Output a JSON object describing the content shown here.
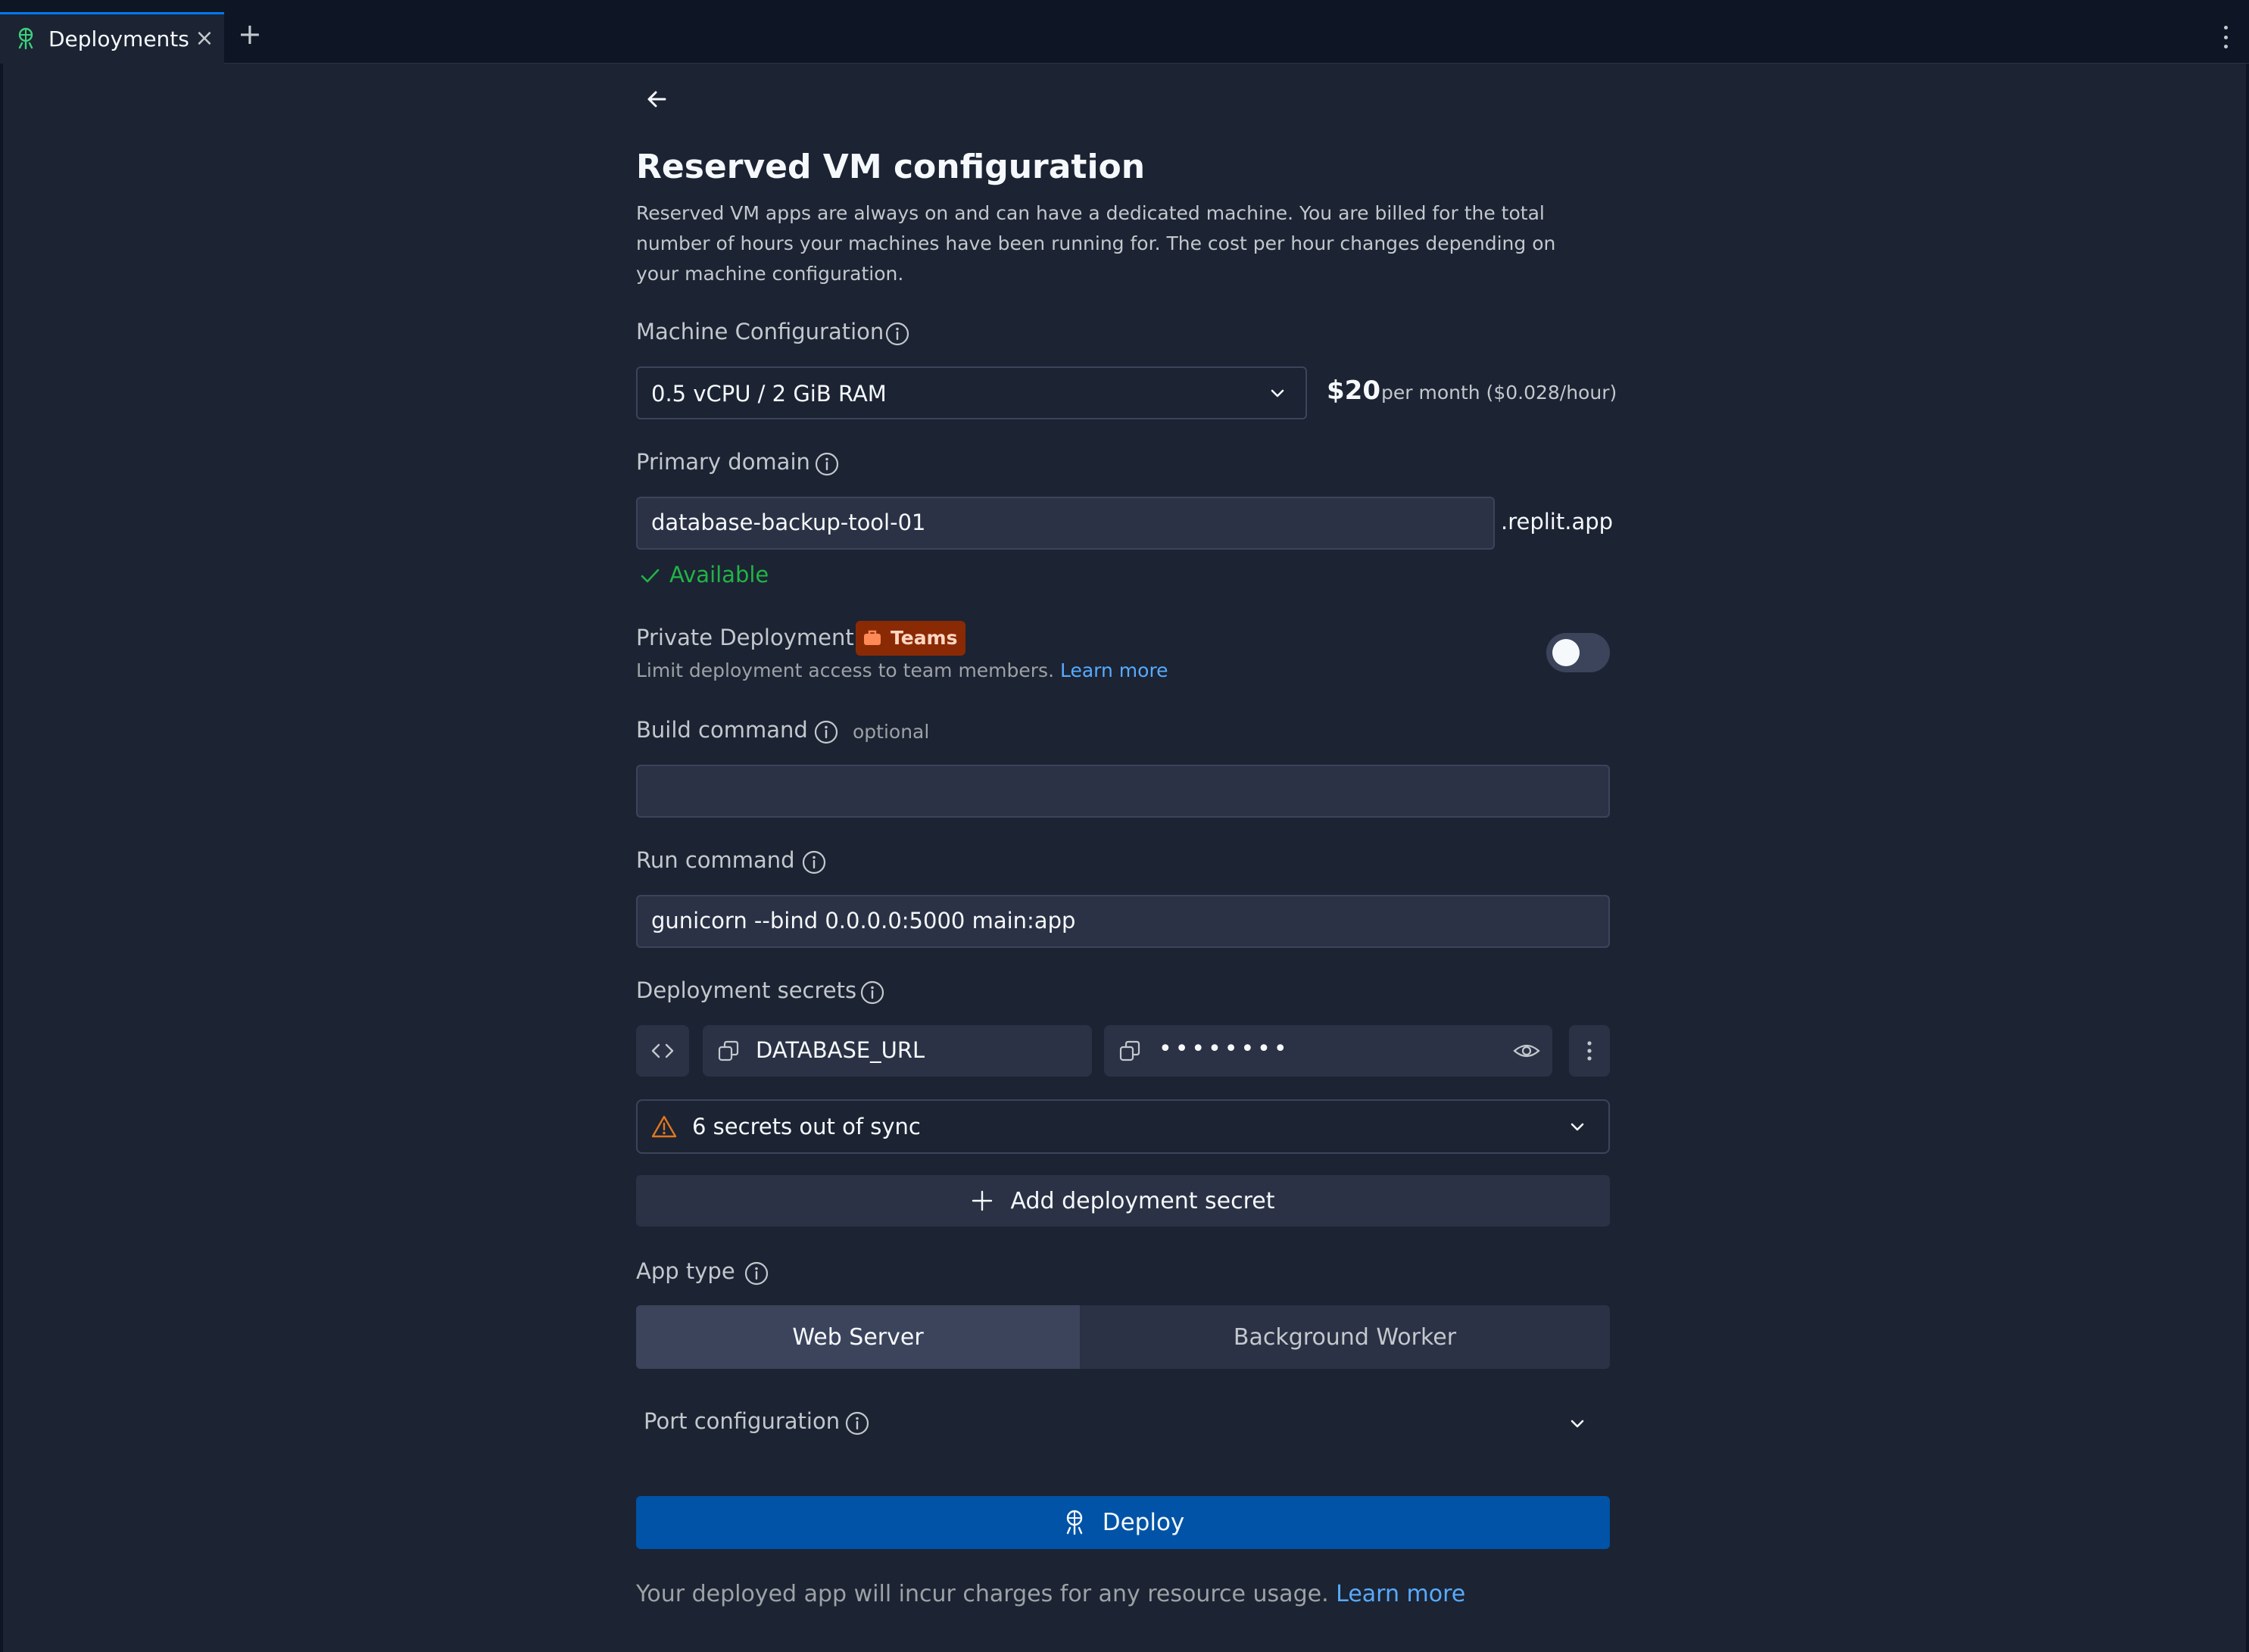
{
  "tabbar": {
    "tab_label": "Deployments",
    "close_symbol": "×",
    "add_symbol": "+"
  },
  "header": {
    "title": "Reserved VM configuration",
    "description": "Reserved VM apps are always on and can have a dedicated machine. You are billed for the total number of hours your machines have been running for. The cost per hour changes depending on your machine configuration."
  },
  "machine": {
    "label": "Machine Configuration",
    "selected": "0.5 vCPU / 2 GiB RAM",
    "price": "$20",
    "price_note": "per month ($0.028/hour)"
  },
  "domain": {
    "label": "Primary domain",
    "value": "database-backup-tool-01",
    "suffix": ".replit.app",
    "status": "Available"
  },
  "private": {
    "label": "Private Deployment",
    "badge": "Teams",
    "description": "Limit deployment access to team members.",
    "link": "Learn more",
    "enabled": false
  },
  "build": {
    "label": "Build command",
    "optional": "optional",
    "value": ""
  },
  "run": {
    "label": "Run command",
    "value": "gunicorn --bind 0.0.0.0:5000 main:app"
  },
  "secrets": {
    "label": "Deployment secrets",
    "key": "DATABASE_URL",
    "masked_value": "••••••••",
    "sync_text": "6 secrets out of sync",
    "add_label": "Add deployment secret"
  },
  "app_type": {
    "label": "App type",
    "options": [
      "Web Server",
      "Background Worker"
    ],
    "selected": "Web Server"
  },
  "port": {
    "label": "Port configuration"
  },
  "deploy": {
    "label": "Deploy",
    "note": "Your deployed app will incur charges for any resource usage.",
    "note_link": "Learn more"
  },
  "colors": {
    "background": "#1c2333",
    "accent": "#0053a6",
    "success": "#21b445",
    "warning": "#e0781f",
    "link": "#57abff",
    "badge": "#8a2a05"
  }
}
